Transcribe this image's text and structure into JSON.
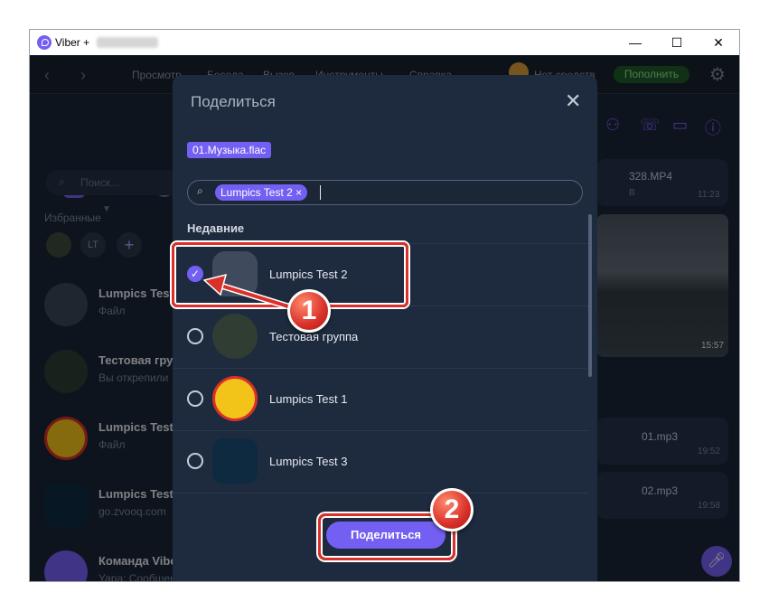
{
  "window": {
    "title": "Viber +",
    "controls": {
      "minimize": "—",
      "maximize": "☐",
      "close": "✕"
    }
  },
  "menubar": {
    "back": "‹",
    "forward": "›",
    "items": [
      "Просмотр",
      "Беседа",
      "Вызов",
      "Инструменты",
      "Справка"
    ],
    "balance_text": "Нет средств",
    "topup": "Пополнить"
  },
  "left": {
    "search_placeholder": "Поиск...",
    "favorites_label": "Избранные",
    "fav_initials": "LT",
    "fav_add": "+",
    "chats": [
      {
        "name": "Lumpics Test",
        "sub": "Файл"
      },
      {
        "name": "Тестовая гру",
        "sub": "Вы открепили"
      },
      {
        "name": "Lumpics Test",
        "sub": "Файл"
      },
      {
        "name": "Lumpics Test",
        "sub": "go.zvooq.com"
      },
      {
        "name": "Команда Viber",
        "sub": "Yapa: Сообщение со стикером"
      }
    ]
  },
  "right": {
    "msg1_name": "328.MP4",
    "msg1_size": "В",
    "msg1_time": "11:23",
    "photo_time": "15:57",
    "msg2_name": "01.mp3",
    "msg2_time": "19:52",
    "msg3_name": "02.mp3",
    "msg3_time": "19:58"
  },
  "dialog": {
    "title": "Поделиться",
    "close": "✕",
    "file_chip": "01.Музыка.flac",
    "selected_chip": "Lumpics Test 2 ×",
    "section": "Недавние",
    "contacts": [
      {
        "name": "Lumpics Test 2",
        "checked": true
      },
      {
        "name": "Тестовая группа",
        "checked": false
      },
      {
        "name": "Lumpics Test 1",
        "checked": false
      },
      {
        "name": "Lumpics Test 3",
        "checked": false
      }
    ],
    "share_button": "Поделиться"
  },
  "annotations": {
    "step1": "1",
    "step2": "2"
  },
  "colors": {
    "accent": "#7360f2",
    "annotation": "#d9302a",
    "bg": "#1b2637"
  }
}
